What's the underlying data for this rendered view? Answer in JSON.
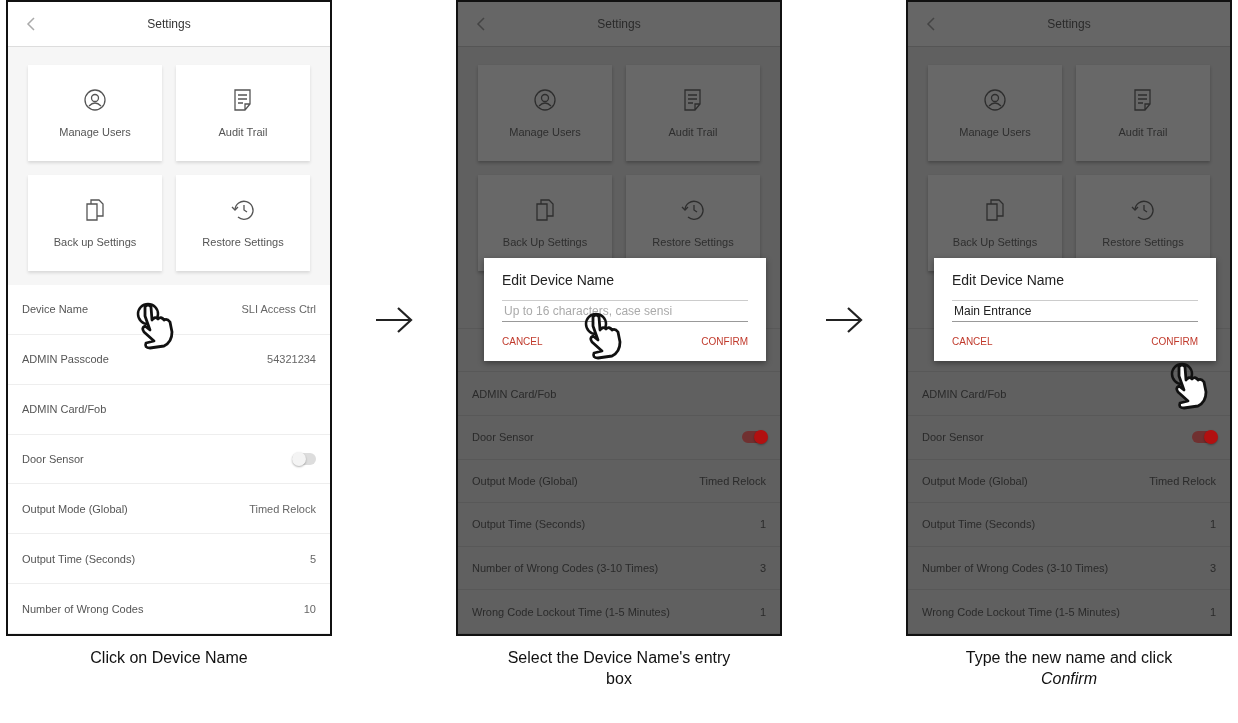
{
  "steps": [
    {
      "screen": {
        "title": "Settings",
        "dimmed": false,
        "tiles": [
          {
            "label": "Manage Users"
          },
          {
            "label": "Audit Trail"
          },
          {
            "label": "Back up Settings"
          },
          {
            "label": "Restore Settings"
          }
        ],
        "rows": [
          {
            "kind": "value",
            "label": "Device Name",
            "value": "SLI Access Ctrl"
          },
          {
            "kind": "value",
            "label": "ADMIN Passcode",
            "value": "54321234"
          },
          {
            "kind": "plain",
            "label": "ADMIN Card/Fob"
          },
          {
            "kind": "toggle",
            "label": "Door Sensor",
            "on": false
          },
          {
            "kind": "value",
            "label": "Output Mode (Global)",
            "value": "Timed Relock"
          },
          {
            "kind": "value",
            "label": "Output Time (Seconds)",
            "value": "5"
          },
          {
            "kind": "value",
            "label": "Number of Wrong Codes",
            "value": "10"
          }
        ]
      },
      "caption": "Click on Device Name"
    },
    {
      "screen": {
        "title": "Settings",
        "dimmed": true,
        "tiles": [
          {
            "label": "Manage Users"
          },
          {
            "label": "Audit Trail"
          },
          {
            "label": "Back Up Settings"
          },
          {
            "label": "Restore Settings"
          }
        ],
        "rows": [
          {
            "kind": "covered"
          },
          {
            "kind": "covered"
          },
          {
            "kind": "plain",
            "label": "ADMIN Card/Fob"
          },
          {
            "kind": "toggle",
            "label": "Door Sensor",
            "on": true
          },
          {
            "kind": "value",
            "label": "Output Mode (Global)",
            "value": "Timed Relock"
          },
          {
            "kind": "value",
            "label": "Output Time (Seconds)",
            "value": "1"
          },
          {
            "kind": "value",
            "label": "Number of Wrong Codes (3-10 Times)",
            "value": "3"
          },
          {
            "kind": "value",
            "label": "Wrong Code Lockout Time (1-5 Minutes)",
            "value": "1"
          }
        ],
        "dialog": {
          "title": "Edit Device Name",
          "field": {
            "placeholder": "Up to 16 characters, case sensi"
          },
          "buttons": [
            {
              "label": "CANCEL"
            },
            {
              "label": "CONFIRM"
            }
          ]
        }
      },
      "caption": "Select the Device Name's entry box"
    },
    {
      "screen": {
        "title": "Settings",
        "dimmed": true,
        "tiles": [
          {
            "label": "Manage Users"
          },
          {
            "label": "Audit Trail"
          },
          {
            "label": "Back Up Settings"
          },
          {
            "label": "Restore Settings"
          }
        ],
        "rows": [
          {
            "kind": "covered"
          },
          {
            "kind": "covered"
          },
          {
            "kind": "plain",
            "label": "ADMIN Card/Fob"
          },
          {
            "kind": "toggle",
            "label": "Door Sensor",
            "on": true
          },
          {
            "kind": "value",
            "label": "Output Mode (Global)",
            "value": "Timed Relock"
          },
          {
            "kind": "value",
            "label": "Output Time (Seconds)",
            "value": "1"
          },
          {
            "kind": "value",
            "label": "Number of Wrong Codes (3-10 Times)",
            "value": "3"
          },
          {
            "kind": "value",
            "label": "Wrong Code Lockout Time (1-5 Minutes)",
            "value": "1"
          }
        ],
        "dialog": {
          "title": "Edit Device Name",
          "field": {
            "value": "Main Entrance"
          },
          "buttons": [
            {
              "label": "CANCEL"
            },
            {
              "label": "CONFIRM"
            }
          ]
        }
      },
      "caption": "Type the new name and click *Confirm*"
    }
  ]
}
